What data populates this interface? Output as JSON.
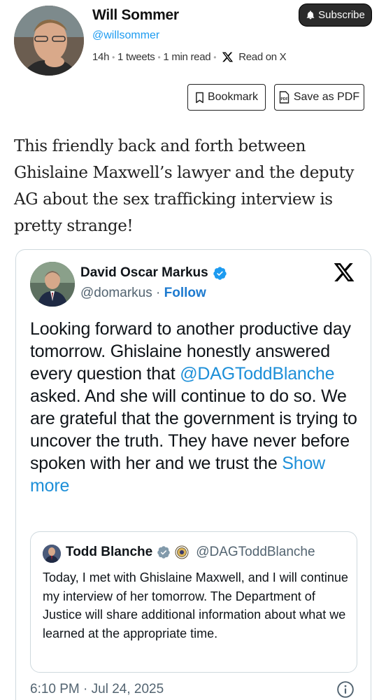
{
  "article": {
    "author_name": "Will Sommer",
    "author_handle": "@willsommer",
    "time_ago": "14h",
    "tweets_count": "1 tweets",
    "read_time": "1 min read",
    "read_on_x": "Read on X",
    "subscribe_label": "Subscribe",
    "bookmark_label": "Bookmark",
    "save_pdf_label": "Save as PDF",
    "text": "This friendly back and forth between Ghislaine Maxwell’s lawyer and the deputy AG about the sex trafficking interview is pretty strange!"
  },
  "embed": {
    "name": "David Oscar Markus",
    "handle": "@domarkus",
    "separator": "·",
    "follow_label": "Follow",
    "body_part1": "Looking forward to another productive day tomorrow. Ghislaine honestly answered every question that ",
    "mention": "@DAGToddBlanche",
    "body_part2": " asked. And she will continue to do so. We are grateful that the government is trying to uncover the truth. They have never before spoken with her and we trust the ",
    "show_more": "Show more",
    "date": "6:10 PM · Jul 24, 2025",
    "quote": {
      "name": "Todd Blanche",
      "handle": "@DAGToddBlanche",
      "body": "Today, I met with Ghislaine Maxwell, and I will continue my interview of her tomorrow. The Department of Justice will share additional information about what we learned at the appropriate time."
    }
  },
  "icons": {
    "bell": "bell-icon",
    "bookmark": "bookmark-icon",
    "pdf": "pdf-icon",
    "x_logo": "x-logo-icon",
    "verified": "verified-badge-icon",
    "info": "info-icon"
  },
  "colors": {
    "link_blue": "#1d9bf0",
    "verified_blue": "#1d9bf0",
    "verified_gray": "#829aab",
    "subscribe_bg": "#2b2b2b"
  }
}
